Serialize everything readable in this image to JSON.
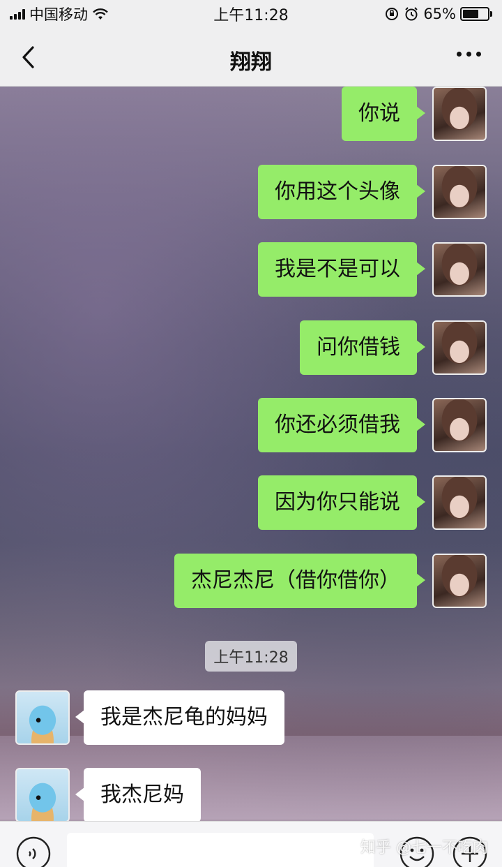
{
  "status_bar": {
    "carrier": "中国移动",
    "time": "上午11:28",
    "battery": "65%",
    "battery_level": 0.65
  },
  "nav": {
    "title": "翔翔"
  },
  "messages": [
    {
      "side": "out",
      "text": "你说"
    },
    {
      "side": "out",
      "text": "你用这个头像"
    },
    {
      "side": "out",
      "text": "我是不是可以"
    },
    {
      "side": "out",
      "text": "问你借钱"
    },
    {
      "side": "out",
      "text": "你还必须借我"
    },
    {
      "side": "out",
      "text": "因为你只能说"
    },
    {
      "side": "out",
      "text": "杰尼杰尼（借你借你）"
    },
    {
      "side": "in",
      "text": "我是杰尼龟的妈妈"
    },
    {
      "side": "in",
      "text": "我杰尼妈"
    }
  ],
  "timestamp": "上午11:28",
  "watermark": "知乎 @七一不吃肉",
  "colors": {
    "bubble_out": "#95ec69",
    "bubble_in": "#ffffff",
    "bar_bg": "#efeff0"
  }
}
